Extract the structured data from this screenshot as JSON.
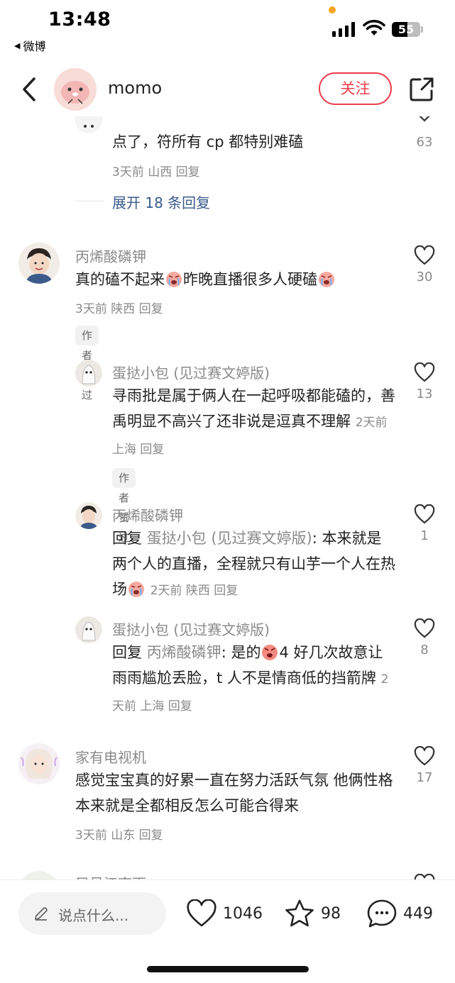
{
  "status_bar": {
    "time": "13:48",
    "back_app": "微博",
    "battery": "55"
  },
  "header": {
    "username": "momo",
    "follow_label": "关注"
  },
  "comments": {
    "partial": {
      "text": "点了，符所有 cp 都特别难磕",
      "meta": "3天前 山西 回复",
      "likes": "63"
    },
    "expand_label": "展开 18 条回复",
    "c1": {
      "username": "丙烯酸磷钾",
      "text_a": "真的磕不起来",
      "text_b": "昨晚直播很多人硬磕",
      "meta": "3天前 陕西 回复",
      "badge": "作者赞过",
      "likes": "30"
    },
    "r1": {
      "username": "蛋挞小包 (见过赛文婷版)",
      "text": "寻雨批是属于俩人在一起呼吸都能磕的，善禹明显不高兴了还非说是逗真不理解",
      "meta": "2天前 上海 回复",
      "badge": "作者赞过",
      "likes": "13"
    },
    "r2": {
      "username": "丙烯酸磷钾",
      "reply_prefix": "回复 ",
      "reply_to": "蛋挞小包 (见过赛文婷版)",
      "text": ": 本来就是两个人的直播，全程就只有山芋一个人在热场",
      "meta": "2天前 陕西 回复",
      "likes": "1"
    },
    "r3": {
      "username": "蛋挞小包 (见过赛文婷版)",
      "reply_prefix": "回复 ",
      "reply_to": "丙烯酸磷钾",
      "text_a": ": 是的",
      "text_b": "4 好几次故意让雨雨尴尬丢脸，t 人不是情商低的挡箭牌",
      "meta": "2天前 上海 回复",
      "likes": "8"
    },
    "c2": {
      "username": "家有电视机",
      "text": "感觉宝宝真的好累一直在努力活跃气氛 他俩性格本来就是全都相反怎么可能合得来",
      "meta": "3天前 山东 回复",
      "likes": "17"
    },
    "c3": {
      "username": "又见江南雨"
    }
  },
  "bottom_bar": {
    "input_placeholder": "说点什么...",
    "likes": "1046",
    "favorites": "98",
    "comments": "449"
  },
  "colors": {
    "accent": "#ee3d4a",
    "link": "#3a5a8c",
    "secondary_text": "#8a8a8a"
  }
}
